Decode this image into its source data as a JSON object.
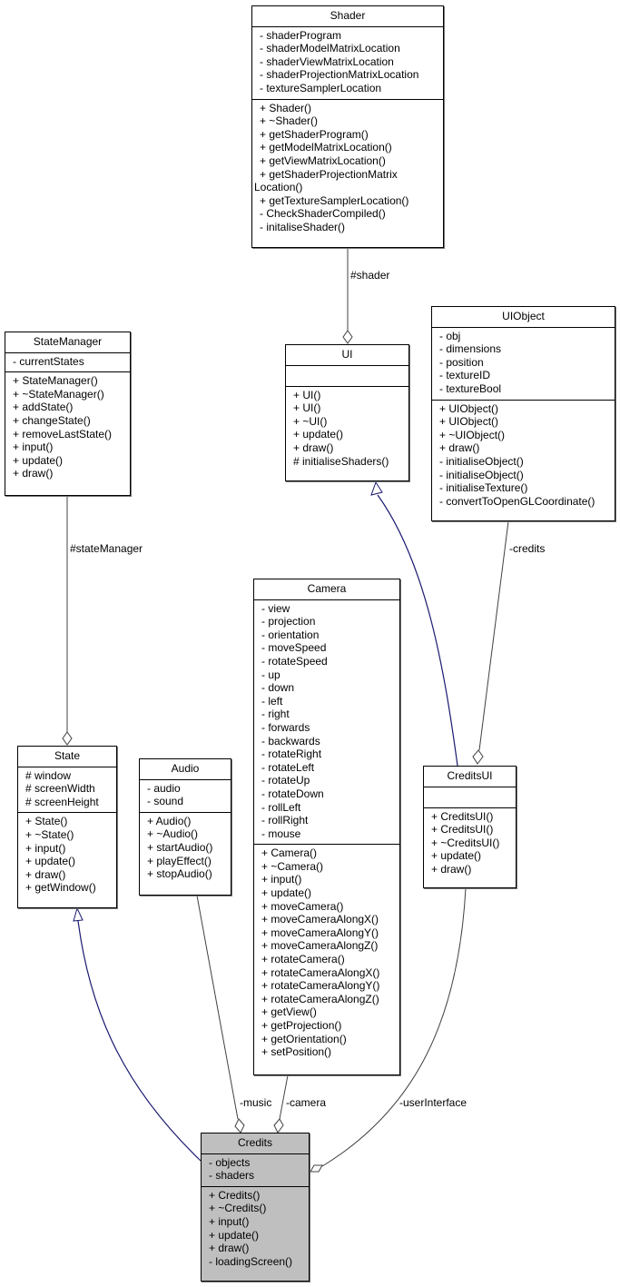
{
  "diagram": {
    "type": "uml-collaboration",
    "focus_class": "Credits",
    "colors": {
      "focus_fill": "#bfbfbf",
      "inheritance_edge": "#191970",
      "association_edge": "#404040"
    }
  },
  "classes": {
    "shader": {
      "name": "Shader",
      "attributes": [
        "- shaderProgram",
        "- shaderModelMatrixLocation",
        "- shaderViewMatrixLocation",
        "- shaderProjectionMatrixLocation",
        "- textureSamplerLocation"
      ],
      "methods": [
        "+ Shader()",
        "+ ~Shader()",
        "+ getShaderProgram()",
        "+ getModelMatrixLocation()",
        "+ getViewMatrixLocation()",
        "+ getShaderProjectionMatrix",
        "Location()",
        "+ getTextureSamplerLocation()",
        "- CheckShaderCompiled()",
        "- initaliseShader()"
      ]
    },
    "statemanager": {
      "name": "StateManager",
      "attributes": [
        "- currentStates"
      ],
      "methods": [
        "+ StateManager()",
        "+ ~StateManager()",
        "+ addState()",
        "+ changeState()",
        "+ removeLastState()",
        "+ input()",
        "+ update()",
        "+ draw()"
      ]
    },
    "ui": {
      "name": "UI",
      "attributes": [],
      "methods": [
        "+ UI()",
        "+ UI()",
        "+ ~UI()",
        "+ update()",
        "+ draw()",
        "# initialiseShaders()"
      ]
    },
    "uiobject": {
      "name": "UIObject",
      "attributes": [
        "- obj",
        "- dimensions",
        "- position",
        "- textureID",
        "- textureBool"
      ],
      "methods": [
        "+ UIObject()",
        "+ UIObject()",
        "+ ~UIObject()",
        "+ draw()",
        "- initialiseObject()",
        "- initialiseObject()",
        "- initialiseTexture()",
        "- convertToOpenGLCoordinate()"
      ]
    },
    "camera": {
      "name": "Camera",
      "attributes": [
        "- view",
        "- projection",
        "- orientation",
        "- moveSpeed",
        "- rotateSpeed",
        "- up",
        "- down",
        "- left",
        "- right",
        "- forwards",
        "- backwards",
        "- rotateRight",
        "- rotateLeft",
        "- rotateUp",
        "- rotateDown",
        "- rollLeft",
        "- rollRight",
        "- mouse"
      ],
      "methods": [
        "+ Camera()",
        "+ ~Camera()",
        "+ input()",
        "+ update()",
        "+ moveCamera()",
        "+ moveCameraAlongX()",
        "+ moveCameraAlongY()",
        "+ moveCameraAlongZ()",
        "+ rotateCamera()",
        "+ rotateCameraAlongX()",
        "+ rotateCameraAlongY()",
        "+ rotateCameraAlongZ()",
        "+ getView()",
        "+ getProjection()",
        "+ getOrientation()",
        "+ setPosition()"
      ]
    },
    "state": {
      "name": "State",
      "attributes": [
        "# window",
        "# screenWidth",
        "# screenHeight"
      ],
      "methods": [
        "+ State()",
        "+ ~State()",
        "+ input()",
        "+ update()",
        "+ draw()",
        "+ getWindow()"
      ]
    },
    "audio": {
      "name": "Audio",
      "attributes": [
        "- audio",
        "- sound"
      ],
      "methods": [
        "+ Audio()",
        "+ ~Audio()",
        "+ startAudio()",
        "+ playEffect()",
        "+ stopAudio()"
      ]
    },
    "creditsui": {
      "name": "CreditsUI",
      "attributes": [],
      "methods": [
        "+ CreditsUI()",
        "+ CreditsUI()",
        "+ ~CreditsUI()",
        "+ update()",
        "+ draw()"
      ]
    },
    "credits": {
      "name": "Credits",
      "attributes": [
        "- objects",
        "- shaders"
      ],
      "methods": [
        "+ Credits()",
        "+ ~Credits()",
        "+ input()",
        "+ update()",
        "+ draw()",
        "- loadingScreen()"
      ]
    }
  },
  "edges": [
    {
      "from": "Shader",
      "to": "UI",
      "kind": "aggregation",
      "label": "#shader"
    },
    {
      "from": "StateManager",
      "to": "State",
      "kind": "aggregation",
      "label": "#stateManager"
    },
    {
      "from": "CreditsUI",
      "to": "UI",
      "kind": "inheritance",
      "label": ""
    },
    {
      "from": "UIObject",
      "to": "CreditsUI",
      "kind": "aggregation",
      "label": "-credits"
    },
    {
      "from": "Credits",
      "to": "State",
      "kind": "inheritance",
      "label": ""
    },
    {
      "from": "Audio",
      "to": "Credits",
      "kind": "aggregation",
      "label": "-music"
    },
    {
      "from": "Camera",
      "to": "Credits",
      "kind": "aggregation",
      "label": "-camera"
    },
    {
      "from": "CreditsUI",
      "to": "Credits",
      "kind": "aggregation",
      "label": "-userInterface"
    }
  ]
}
